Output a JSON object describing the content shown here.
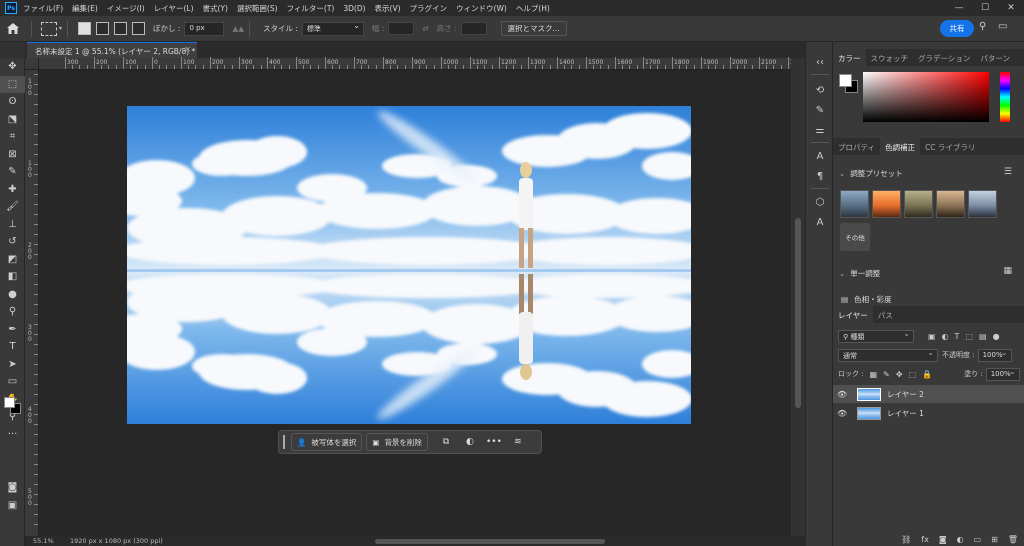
{
  "menubar": {
    "logo": "Ps",
    "items": [
      "ファイル(F)",
      "編集(E)",
      "イメージ(I)",
      "レイヤー(L)",
      "書式(Y)",
      "選択範囲(S)",
      "フィルター(T)",
      "3D(D)",
      "表示(V)",
      "プラグイン",
      "ウィンドウ(W)",
      "ヘルプ(H)"
    ],
    "window_controls": [
      "—",
      "☐",
      "✕"
    ]
  },
  "options_bar": {
    "feather_label": "ぼかし :",
    "feather_value": "0 px",
    "style_label": "スタイル :",
    "style_value": "標準",
    "width_label": "幅 :",
    "height_label": "高さ :",
    "select_mask_button": "選択とマスク...",
    "share_button": "共有"
  },
  "document": {
    "tab_title": "名称未設定 1 @ 55.1% (レイヤー 2, RGB/8) *",
    "ruler_h_labels": [
      "300",
      "200",
      "100",
      "0",
      "100",
      "200",
      "300",
      "400",
      "500",
      "600",
      "700",
      "800",
      "900",
      "1000",
      "1100",
      "1200",
      "1300",
      "1400",
      "1500",
      "1600",
      "1700",
      "1800",
      "1900",
      "2000",
      "2100",
      "2200"
    ],
    "ruler_v_labels": [
      "1",
      "0",
      "0",
      "1",
      "0",
      "0",
      "2",
      "0",
      "0",
      "3",
      "0",
      "0",
      "4",
      "0",
      "0",
      "5",
      "0",
      "0"
    ]
  },
  "status": {
    "zoom": "55.1%",
    "doc_info": "1920 px x 1080 px (300 ppi)"
  },
  "context_bar": {
    "select_subject": "被写体を選択",
    "remove_background": "背景を削除",
    "more": "•••"
  },
  "color_panel": {
    "tabs": [
      "カラー",
      "スウォッチ",
      "グラデーション",
      "パターン"
    ]
  },
  "adjust_panel": {
    "tabs": [
      "プロパティ",
      "色調補正",
      "CC ライブラリ"
    ],
    "presets_title": "調整プリセット",
    "other_label": "その他",
    "single_title": "単一調整",
    "hue_sat": "色相・彩度"
  },
  "layers_panel": {
    "tabs": [
      "レイヤー",
      "パス"
    ],
    "filter_kind": "種類",
    "blend_mode": "通常",
    "opacity_label": "不透明度 :",
    "opacity_value": "100%",
    "lock_label": "ロック :",
    "fill_label": "塗り :",
    "fill_value": "100%",
    "layers": [
      {
        "name": "レイヤー 2",
        "selected": true
      },
      {
        "name": "レイヤー 1",
        "selected": false
      }
    ],
    "bottom_icons": [
      "link-icon",
      "fx-icon",
      "mask-icon",
      "adjustment-icon",
      "folder-icon",
      "new-layer-icon",
      "trash-icon"
    ]
  },
  "colors": {
    "accent": "#1473e6",
    "panel_bg": "#393939",
    "canvas_bg": "#272727"
  }
}
